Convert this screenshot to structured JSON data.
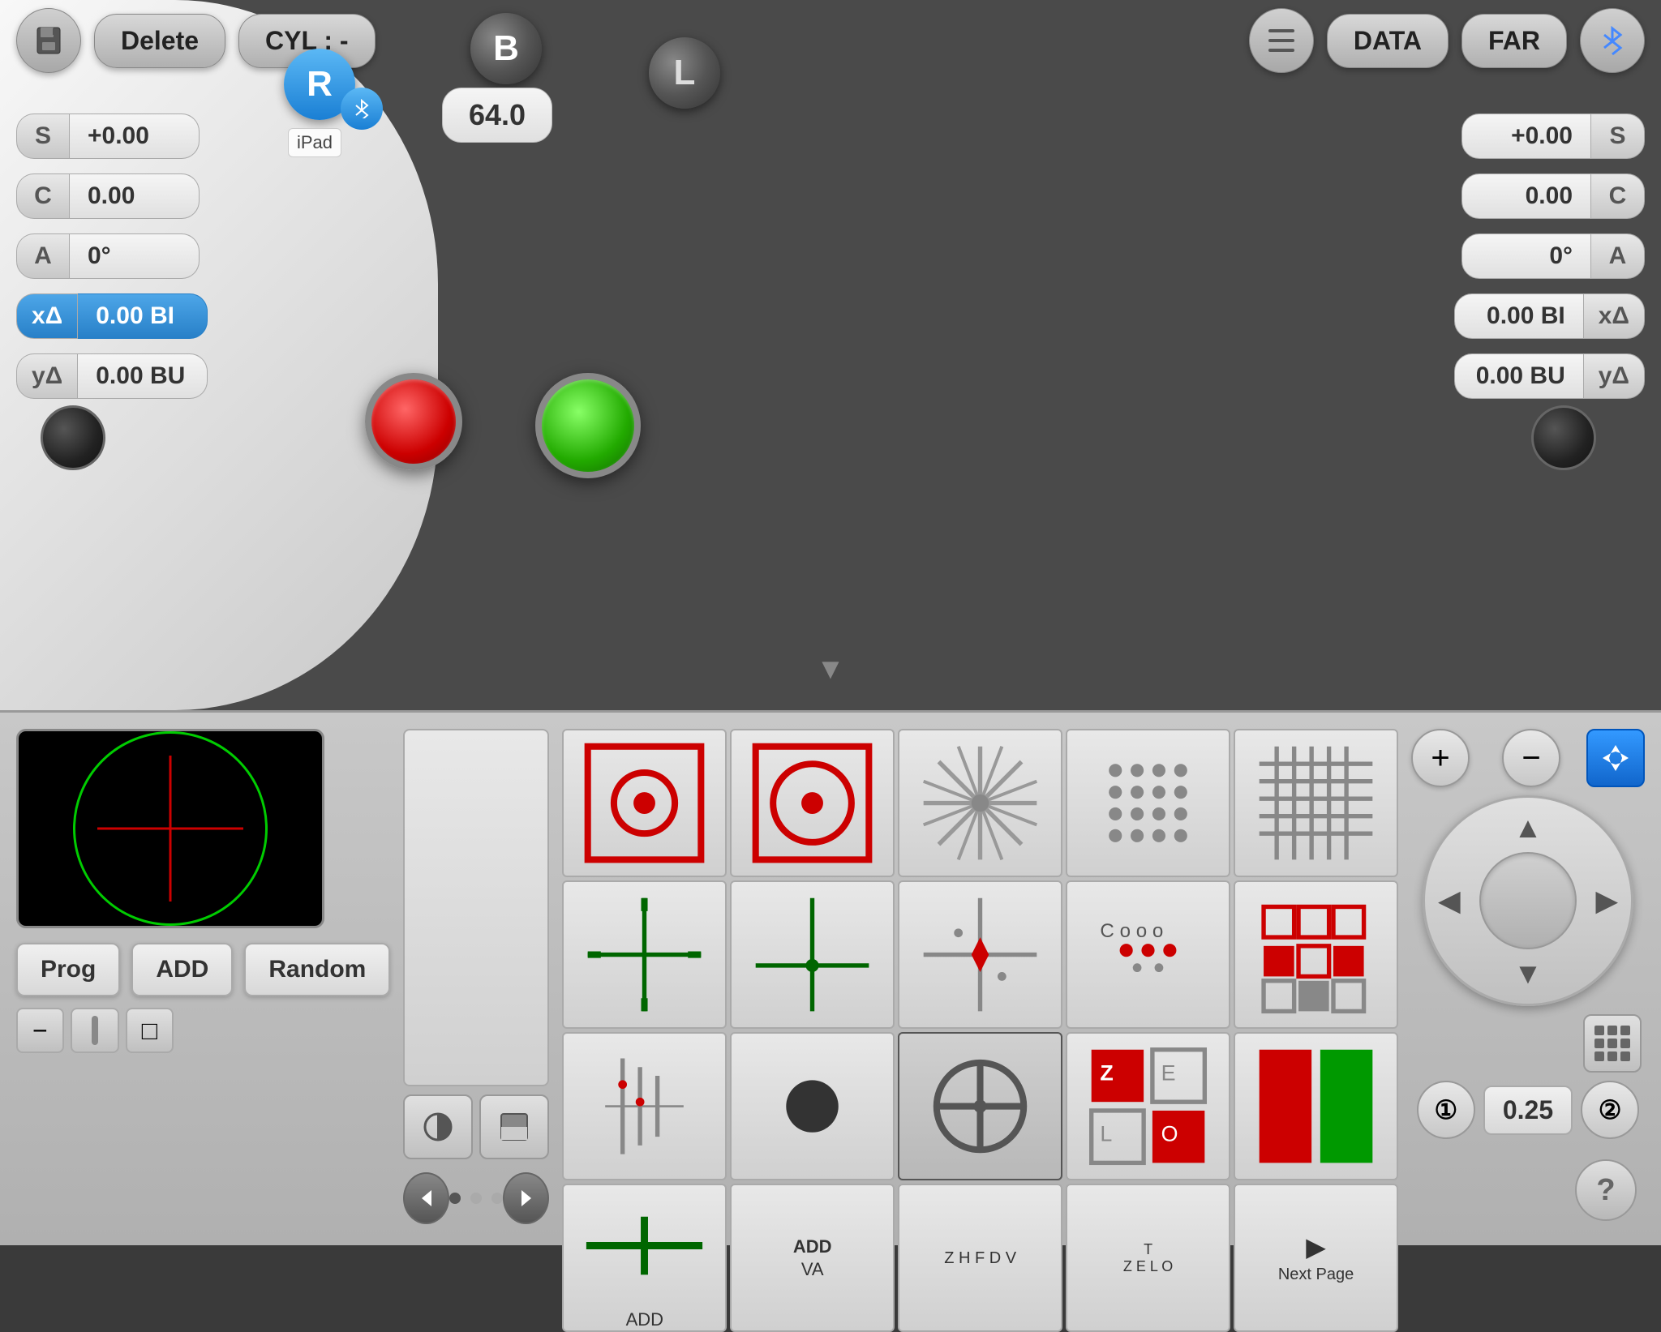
{
  "toolbar": {
    "save_icon": "💾",
    "delete_label": "Delete",
    "cyl_label": "CYL : -",
    "list_icon": "☰",
    "data_label": "DATA",
    "far_label": "FAR",
    "bluetooth_icon": "B"
  },
  "left_panel": {
    "r_label": "R",
    "ipad_label": "iPad",
    "fields": [
      {
        "label": "S",
        "value": "+0.00",
        "active": false
      },
      {
        "label": "C",
        "value": "0.00",
        "active": false
      },
      {
        "label": "A",
        "value": "0°",
        "active": false
      },
      {
        "label": "xΔ",
        "value": "0.00 BI",
        "active": true
      },
      {
        "label": "yΔ",
        "value": "0.00 BU",
        "active": false
      }
    ]
  },
  "right_panel": {
    "fields": [
      {
        "label": "S",
        "value": "+0.00"
      },
      {
        "label": "C",
        "value": "0.00"
      },
      {
        "label": "A",
        "value": "0°"
      },
      {
        "label": "xΔ",
        "value": "0.00 BI"
      },
      {
        "label": "yΔ",
        "value": "0.00 BU"
      }
    ]
  },
  "center": {
    "b_label": "B",
    "pupil_value": "64.0",
    "l_label": "L"
  },
  "bottom_panel": {
    "chart_cells": [
      {
        "id": 0,
        "type": "ring-red",
        "label": ""
      },
      {
        "id": 1,
        "type": "ring-red-outer",
        "label": ""
      },
      {
        "id": 2,
        "type": "starburst",
        "label": ""
      },
      {
        "id": 3,
        "type": "dots",
        "label": ""
      },
      {
        "id": 4,
        "type": "grid-lines",
        "label": ""
      },
      {
        "id": 5,
        "type": "crosshair-fine",
        "label": ""
      },
      {
        "id": 6,
        "type": "crosshair-offset",
        "label": ""
      },
      {
        "id": 7,
        "type": "diamond-cross",
        "label": ""
      },
      {
        "id": 8,
        "type": "dots-row",
        "label": ""
      },
      {
        "id": 9,
        "type": "dots-row2",
        "label": ""
      },
      {
        "id": 10,
        "type": "bars-vert",
        "label": ""
      },
      {
        "id": 11,
        "type": "dot-center",
        "label": ""
      },
      {
        "id": 12,
        "type": "circle-cross-selected",
        "label": ""
      },
      {
        "id": 13,
        "type": "squares-red",
        "label": ""
      },
      {
        "id": 14,
        "type": "rect-color",
        "label": ""
      },
      {
        "id": 15,
        "type": "add-cross",
        "label": "ADD"
      },
      {
        "id": 16,
        "type": "add-va",
        "label": "ADD\nVA"
      },
      {
        "id": 17,
        "type": "letters",
        "label": "Z H F D V"
      },
      {
        "id": 18,
        "type": "letters2",
        "label": "T\nZ E L O"
      },
      {
        "id": 19,
        "type": "next-page",
        "label": "Next Page"
      }
    ],
    "prog_buttons": [
      "Prog",
      "ADD",
      "Random"
    ],
    "page_controls": {
      "page1": "①",
      "value": "0.25",
      "page2": "②"
    },
    "nav": {
      "prev_icon": "◀",
      "next_icon": "▶"
    }
  }
}
